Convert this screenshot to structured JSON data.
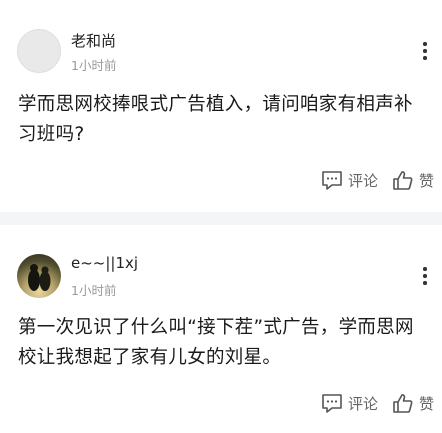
{
  "comments": [
    {
      "username": "老和尚",
      "time": "1小时前",
      "text": "学而思网校捧哏式广告植入，请问咱家有相声补习班吗?",
      "comment_label": "评论",
      "like_label": "赞"
    },
    {
      "username": "e~~||1xj",
      "time": "1小时前",
      "text": "第一次见识了什么叫“接下茬”式广告，学而思网校让我想起了家有儿女的刘星。",
      "comment_label": "评论",
      "like_label": "赞"
    }
  ],
  "icons": [
    "more-icon",
    "comment-icon",
    "like-icon"
  ]
}
